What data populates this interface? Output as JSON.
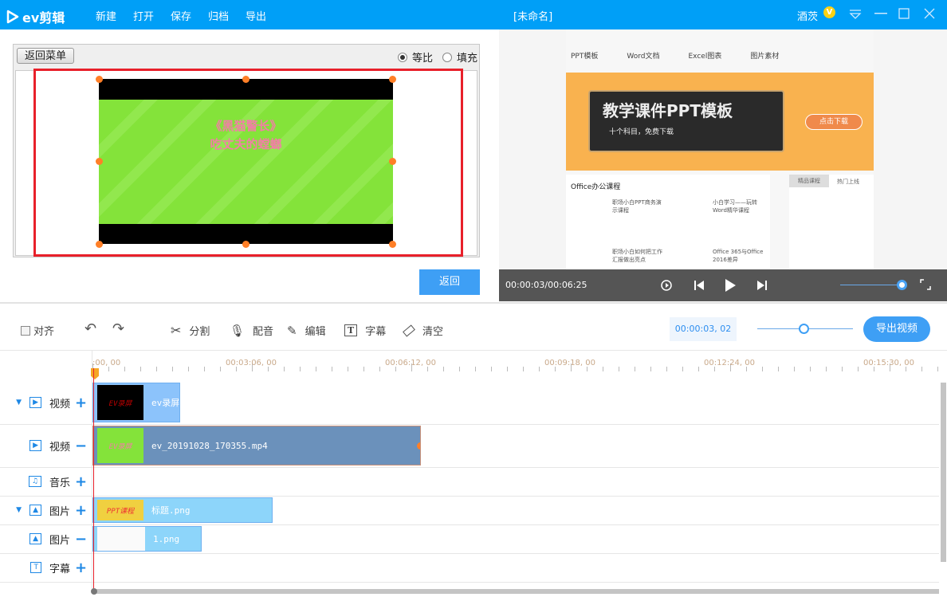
{
  "app": {
    "logo": "ev剪辑",
    "title": "[未命名]",
    "user": "酒茨",
    "vip_badge": "V"
  },
  "menu": [
    "新建",
    "打开",
    "保存",
    "归档",
    "导出"
  ],
  "preview": {
    "back_menu": "返回菜单",
    "ratio_options": [
      {
        "label": "等比",
        "checked": true
      },
      {
        "label": "填充",
        "checked": false
      }
    ],
    "video_text_line1": "《黑猫警长》",
    "video_text_line2": "吃丈夫的螳螂",
    "return": "返回"
  },
  "player": {
    "time": "00:00:03/00:06:25",
    "volume": 0.95,
    "page": {
      "nav": [
        "PPT模板",
        "Word文档",
        "Excel图表",
        "图片素材"
      ],
      "banner_title": "教学课件PPT模板",
      "banner_sub": "十个科目，免费下载",
      "banner_btn": "点击下载",
      "section": "Office办公课程",
      "cards": [
        "职场小白PPT商务演示课程",
        "小白学习——玩转Word精华课程",
        "职场小白如何把工作汇报做出亮点",
        "Office 365与Office 2016差异"
      ],
      "tabs": [
        "精品课程",
        "热门上线"
      ]
    }
  },
  "toolbar": {
    "align": "对齐",
    "split": "分割",
    "dub": "配音",
    "edit": "编辑",
    "subtitle": "字幕",
    "clear": "清空",
    "time": "00:00:03, 02",
    "export": "导出视频",
    "zoom": 0.5
  },
  "timeline": {
    "ticks": [
      "00:00:00, 00",
      "00:03:06, 00",
      "00:06:12, 00",
      "00:09:18, 00",
      "00:12:24, 00",
      "00:15:30, 00"
    ],
    "ticks_visible": [
      ":00, 00",
      "00:03:06, 00",
      "00:06:12, 00",
      "00:09:18, 00",
      "00:12:24, 00",
      "00:15:30, 00"
    ],
    "tracks": [
      {
        "label": "视频",
        "icon": "video-icon",
        "action": "+",
        "expand": true,
        "clip": "ev录屏",
        "thumb": "EV录屏"
      },
      {
        "label": "视频",
        "icon": "video-icon",
        "action": "−",
        "expand": false,
        "clip": "ev_20191028_170355.mp4",
        "thumb": "EV录屏"
      },
      {
        "label": "音乐",
        "icon": "music-icon",
        "action": "+",
        "expand": false,
        "clip": ""
      },
      {
        "label": "图片",
        "icon": "image-icon",
        "action": "+",
        "expand": true,
        "clip": "标题.png",
        "thumb": "PPT课程"
      },
      {
        "label": "图片",
        "icon": "image-icon",
        "action": "−",
        "expand": false,
        "clip": "1.png"
      },
      {
        "label": "字幕",
        "icon": "text-icon",
        "action": "+",
        "expand": false,
        "clip": ""
      }
    ]
  }
}
